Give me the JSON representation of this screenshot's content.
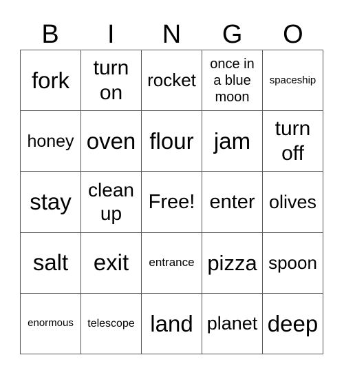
{
  "header": [
    "B",
    "I",
    "N",
    "G",
    "O"
  ],
  "cells": [
    [
      "fork",
      "turn on",
      "rocket",
      "once in a blue moon",
      "spaceship"
    ],
    [
      "honey",
      "oven",
      "flour",
      "jam",
      "turn off"
    ],
    [
      "stay",
      "clean up",
      "Free!",
      "enter",
      "olives"
    ],
    [
      "salt",
      "exit",
      "entrance",
      "pizza",
      "spoon"
    ],
    [
      "enormous",
      "telescope",
      "land",
      "planet",
      "deep"
    ]
  ]
}
